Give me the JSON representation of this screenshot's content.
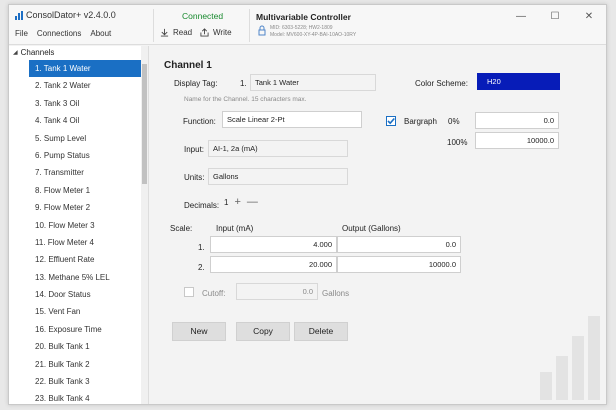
{
  "app": {
    "title": "ConsolDator+ v2.4.0.0",
    "menu": [
      "File",
      "Connections",
      "About"
    ],
    "brand_color": "#1a6fc4"
  },
  "status": {
    "connected": "Connected",
    "read_label": "Read",
    "write_label": "Write"
  },
  "device": {
    "title": "Multivariable Controller",
    "line1": "MID: 6303-5228; HW2-1809",
    "line2": "Model: MV600-XY-4P-BAI-10AO-10RY"
  },
  "window_controls": [
    "—",
    "☐",
    "✕"
  ],
  "sidebar": {
    "group_label": "Channels",
    "items": [
      "1. Tank 1 Water",
      "2. Tank 2 Water",
      "3. Tank 3 Oil",
      "4. Tank 4 Oil",
      "5. Sump Level",
      "6. Pump Status",
      "7. Transmitter",
      "8. Flow Meter 1",
      "9. Flow Meter 2",
      "10. Flow Meter 3",
      "11. Flow Meter 4",
      "12. Effluent Rate",
      "13. Methane 5% LEL",
      "14. Door Status",
      "15. Vent Fan",
      "16. Exposure Time",
      "20. Bulk Tank 1",
      "21. Bulk Tank 2",
      "22. Bulk Tank 3",
      "23. Bulk Tank 4"
    ],
    "active_index": 0
  },
  "channel": {
    "title": "Channel 1",
    "display_tag_label": "Display Tag:",
    "display_tag_number": "1.",
    "display_tag_value": "Tank 1 Water",
    "display_tag_hint": "Name for the Channel. 15 characters max.",
    "color_scheme_label": "Color Scheme:",
    "color_scheme_value": "H20",
    "color_scheme_color": "#071cb8",
    "function_label": "Function:",
    "function_value": "Scale Linear 2-Pt",
    "bargraph_label": "Bargraph",
    "bargraph_checked": true,
    "bargraph_low_pct": "0%",
    "bargraph_low_value": "0.0",
    "bargraph_high_pct": "100%",
    "bargraph_high_value": "10000.0",
    "input_label": "Input:",
    "input_value": "AI-1, 2a (mA)",
    "units_label": "Units:",
    "units_value": "Gallons",
    "decimals_label": "Decimals:",
    "decimals_value": "1",
    "scale_label": "Scale:",
    "scale_input_header": "Input (mA)",
    "scale_output_header": "Output (Gallons)",
    "scale_rows": [
      {
        "index": "1.",
        "input": "4.000",
        "output": "0.0"
      },
      {
        "index": "2.",
        "input": "20.000",
        "output": "10000.0"
      }
    ],
    "cutoff_label": "Cutoff:",
    "cutoff_value": "0.0",
    "cutoff_units": "Gallons",
    "buttons": {
      "new": "New",
      "copy": "Copy",
      "delete": "Delete"
    }
  }
}
